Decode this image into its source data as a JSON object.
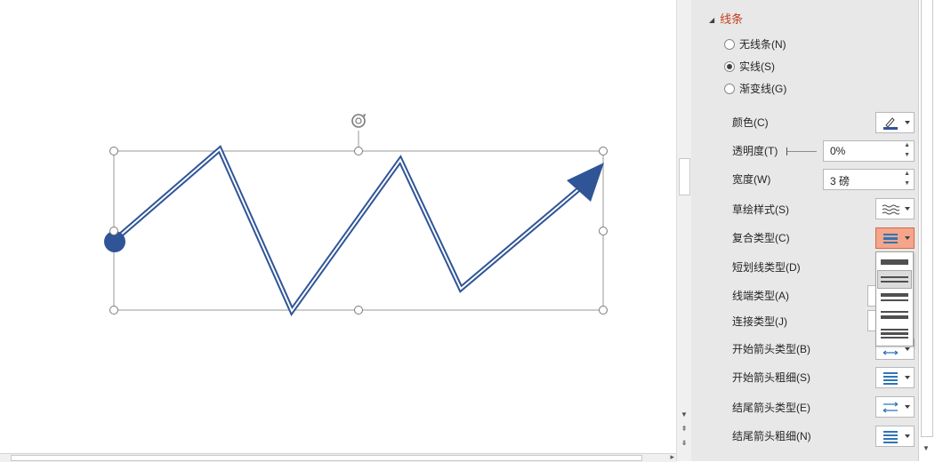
{
  "panel": {
    "section_title": "线条",
    "line_type_options": [
      {
        "label": "无线条(N)",
        "checked": false
      },
      {
        "label": "实线(S)",
        "checked": true
      },
      {
        "label": "渐变线(G)",
        "checked": false
      }
    ],
    "color": {
      "label": "颜色(C)",
      "swatch": "#2f5597"
    },
    "transparency": {
      "label": "透明度(T)",
      "value": "0%"
    },
    "width": {
      "label": "宽度(W)",
      "value": "3 磅"
    },
    "sketch_style": {
      "label": "草绘样式(S)"
    },
    "compound_type": {
      "label": "复合类型(C)",
      "menu_open": true
    },
    "dash_type": {
      "label": "短划线类型(D)"
    },
    "cap_type": {
      "label": "线端类型(A)"
    },
    "join_type": {
      "label": "连接类型(J)"
    },
    "begin_arrow_type": {
      "label": "开始箭头类型(B)"
    },
    "begin_arrow_size": {
      "label": "开始箭头粗细(S)"
    },
    "end_arrow_type": {
      "label": "结尾箭头类型(E)"
    },
    "end_arrow_size": {
      "label": "结尾箭头粗细(N)"
    }
  },
  "compound_menu": {
    "options": [
      "single",
      "double",
      "thick-thin",
      "thin-thick",
      "triple"
    ],
    "hovered": "double"
  },
  "shape": {
    "type": "freeform-zigzag-arrow",
    "line_style": "double",
    "stroke_color": "#2f5597"
  },
  "colors": {
    "accent": "#c43e1c",
    "active_button": "#f4a58a",
    "icon_blue": "#2e75b6"
  }
}
